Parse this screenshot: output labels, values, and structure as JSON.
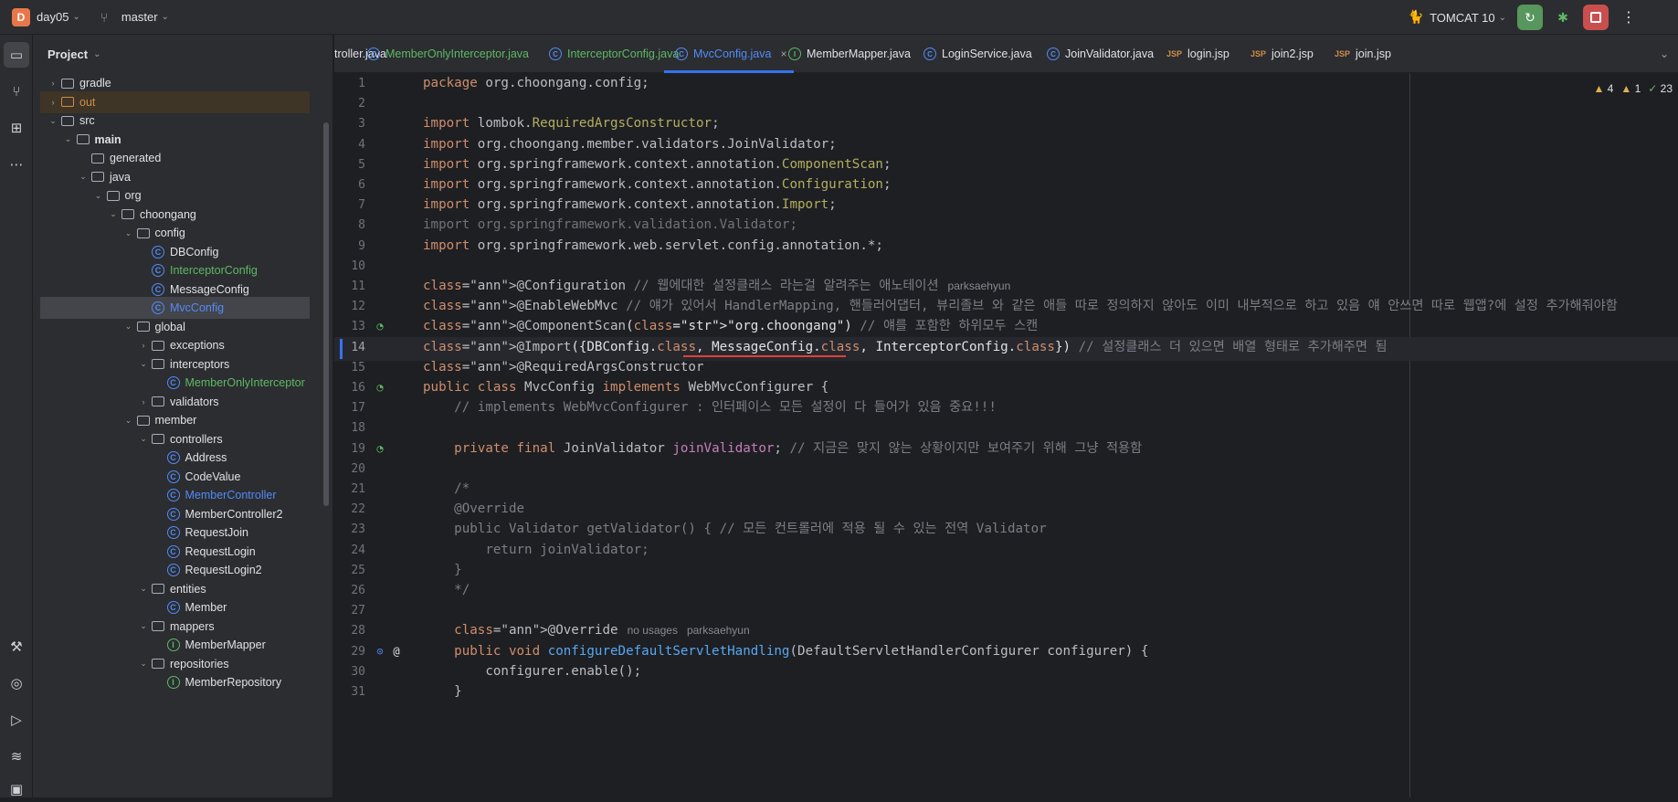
{
  "titlebar": {
    "project_initial": "D",
    "project_name": "day05",
    "branch": "master",
    "run_config": "TOMCAT 10"
  },
  "project_panel": {
    "title": "Project",
    "tree": [
      {
        "label": "gradle",
        "depth": 0,
        "type": "folder",
        "expanded": false
      },
      {
        "label": "out",
        "depth": 0,
        "type": "folder-orange",
        "expanded": false
      },
      {
        "label": "src",
        "depth": 0,
        "type": "folder",
        "expanded": true
      },
      {
        "label": "main",
        "depth": 1,
        "type": "folder",
        "expanded": true
      },
      {
        "label": "generated",
        "depth": 2,
        "type": "folder",
        "expanded": null
      },
      {
        "label": "java",
        "depth": 2,
        "type": "folder",
        "expanded": true
      },
      {
        "label": "org",
        "depth": 3,
        "type": "folder",
        "expanded": true
      },
      {
        "label": "choongang",
        "depth": 4,
        "type": "folder",
        "expanded": true
      },
      {
        "label": "config",
        "depth": 5,
        "type": "folder",
        "expanded": true
      },
      {
        "label": "DBConfig",
        "depth": 6,
        "type": "class"
      },
      {
        "label": "InterceptorConfig",
        "depth": 6,
        "type": "class",
        "color": "green"
      },
      {
        "label": "MessageConfig",
        "depth": 6,
        "type": "class"
      },
      {
        "label": "MvcConfig",
        "depth": 6,
        "type": "class",
        "color": "blue",
        "selected": true
      },
      {
        "label": "global",
        "depth": 5,
        "type": "folder",
        "expanded": true
      },
      {
        "label": "exceptions",
        "depth": 6,
        "type": "folder",
        "expanded": false
      },
      {
        "label": "interceptors",
        "depth": 6,
        "type": "folder",
        "expanded": true
      },
      {
        "label": "MemberOnlyInterceptor",
        "depth": 7,
        "type": "class",
        "color": "green"
      },
      {
        "label": "validators",
        "depth": 6,
        "type": "folder",
        "expanded": false
      },
      {
        "label": "member",
        "depth": 5,
        "type": "folder",
        "expanded": true
      },
      {
        "label": "controllers",
        "depth": 6,
        "type": "folder",
        "expanded": true
      },
      {
        "label": "Address",
        "depth": 7,
        "type": "class"
      },
      {
        "label": "CodeValue",
        "depth": 7,
        "type": "class"
      },
      {
        "label": "MemberController",
        "depth": 7,
        "type": "class",
        "color": "blue"
      },
      {
        "label": "MemberController2",
        "depth": 7,
        "type": "class"
      },
      {
        "label": "RequestJoin",
        "depth": 7,
        "type": "class"
      },
      {
        "label": "RequestLogin",
        "depth": 7,
        "type": "class"
      },
      {
        "label": "RequestLogin2",
        "depth": 7,
        "type": "class"
      },
      {
        "label": "entities",
        "depth": 6,
        "type": "folder",
        "expanded": true
      },
      {
        "label": "Member",
        "depth": 7,
        "type": "class"
      },
      {
        "label": "mappers",
        "depth": 6,
        "type": "folder",
        "expanded": true
      },
      {
        "label": "MemberMapper",
        "depth": 7,
        "type": "interface"
      },
      {
        "label": "repositories",
        "depth": 6,
        "type": "folder",
        "expanded": true
      },
      {
        "label": "MemberRepository",
        "depth": 7,
        "type": "interface"
      }
    ]
  },
  "tabs": [
    {
      "label": "troller.java",
      "icon": "none"
    },
    {
      "label": "MemberOnlyInterceptor.java",
      "icon": "class",
      "color": "green"
    },
    {
      "label": "InterceptorConfig.java",
      "icon": "class",
      "color": "green"
    },
    {
      "label": "MvcConfig.java",
      "icon": "class",
      "color": "blue",
      "active": true
    },
    {
      "label": "MemberMapper.java",
      "icon": "interface"
    },
    {
      "label": "LoginService.java",
      "icon": "class"
    },
    {
      "label": "JoinValidator.java",
      "icon": "class"
    },
    {
      "label": "login.jsp",
      "icon": "jsp"
    },
    {
      "label": "join2.jsp",
      "icon": "jsp"
    },
    {
      "label": "join.jsp",
      "icon": "jsp"
    }
  ],
  "inspections": {
    "warnings": "4",
    "weak_warnings": "1",
    "ok": "23"
  },
  "editor": {
    "current_line": 14,
    "lines": [
      {
        "n": "1",
        "code": "package org.choongang.config;"
      },
      {
        "n": "2",
        "code": ""
      },
      {
        "n": "3",
        "code": "import lombok.RequiredArgsConstructor;"
      },
      {
        "n": "4",
        "code": "import org.choongang.member.validators.JoinValidator;"
      },
      {
        "n": "5",
        "code": "import org.springframework.context.annotation.ComponentScan;"
      },
      {
        "n": "6",
        "code": "import org.springframework.context.annotation.Configuration;"
      },
      {
        "n": "7",
        "code": "import org.springframework.context.annotation.Import;"
      },
      {
        "n": "8",
        "code": "import org.springframework.validation.Validator;"
      },
      {
        "n": "9",
        "code": "import org.springframework.web.servlet.config.annotation.*;"
      },
      {
        "n": "10",
        "code": ""
      },
      {
        "n": "11",
        "code": "@Configuration // 웹에대한 설정클래스 라는걸 알려주는 애노테이션",
        "hint": "parksaehyun"
      },
      {
        "n": "12",
        "code": "@EnableWebMvc // 얘가 있어서 HandlerMapping, 핸들러어댑터, 뷰리졸브 와 같은 애들 따로 정의하지 않아도 이미 내부적으로 하고 있음 얘 안쓰면 따로 웹앱?에 설정 추가해줘야함"
      },
      {
        "n": "13",
        "code": "@ComponentScan(\"org.choongang\") // 얘를 포함한 하위모두 스캔"
      },
      {
        "n": "14",
        "code": "@Import({DBConfig.class, MessageConfig.class, InterceptorConfig.class}) // 설정클래스 더 있으면 배열 형태로 추가해주면 됨"
      },
      {
        "n": "15",
        "code": "@RequiredArgsConstructor"
      },
      {
        "n": "16",
        "code": "public class MvcConfig implements WebMvcConfigurer {"
      },
      {
        "n": "17",
        "code": "    // implements WebMvcConfigurer : 인터페이스 모든 설정이 다 들어가 있음 중요!!!"
      },
      {
        "n": "18",
        "code": ""
      },
      {
        "n": "19",
        "code": "    private final JoinValidator joinValidator; // 지금은 맞지 않는 상황이지만 보여주기 위해 그냥 적용함"
      },
      {
        "n": "20",
        "code": ""
      },
      {
        "n": "21",
        "code": "    /*"
      },
      {
        "n": "22",
        "code": "    @Override"
      },
      {
        "n": "23",
        "code": "    public Validator getValidator() { // 모든 컨트롤러에 적용 될 수 있는 전역 Validator"
      },
      {
        "n": "24",
        "code": "        return joinValidator;"
      },
      {
        "n": "25",
        "code": "    }"
      },
      {
        "n": "26",
        "code": "    */"
      },
      {
        "n": "27",
        "code": ""
      },
      {
        "n": "28",
        "code": "    @Override",
        "hint": "no usages   parksaehyun"
      },
      {
        "n": "29",
        "code": "    public void configureDefaultServletHandling(DefaultServletHandlerConfigurer configurer) {"
      },
      {
        "n": "30",
        "code": "        configurer.enable();"
      },
      {
        "n": "31",
        "code": "    }"
      }
    ]
  },
  "colors": {
    "accent": "#3574f0",
    "keyword": "#cf8e6d",
    "annotation": "#b3ae60",
    "string": "#6aab73",
    "comment": "#7a7e85",
    "class_icon": "#548af7",
    "interface_icon": "#5fb865"
  }
}
